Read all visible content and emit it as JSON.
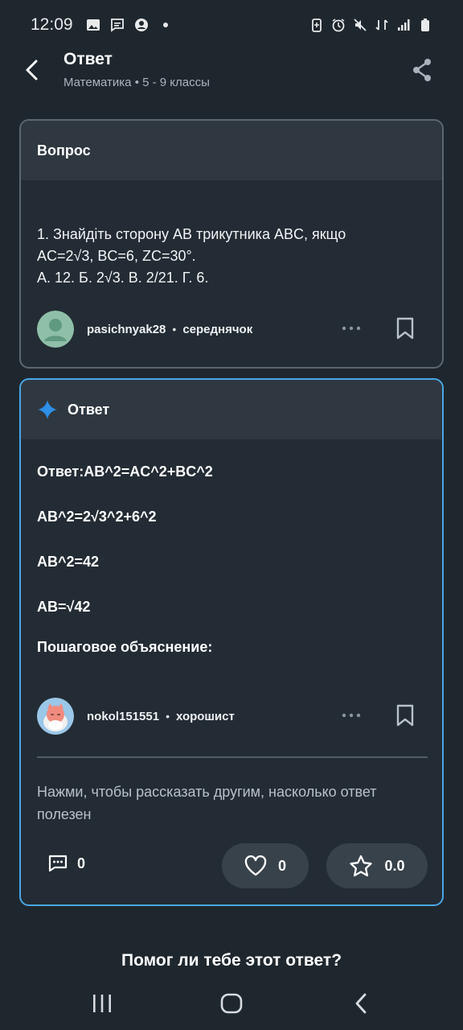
{
  "status_bar": {
    "time": "12:09"
  },
  "header": {
    "title": "Ответ",
    "subtitle": "Математика • 5 - 9 классы"
  },
  "question": {
    "header": "Вопрос",
    "lines": [
      "1. Знайдіть сторону AB трикутника ABC, якщо",
      "AC=2√3, BC=6, ZC=30°.",
      "А. 12. Б. 2√3. В. 2/21. Г. 6."
    ],
    "author": {
      "name": "pasichnyak28",
      "separator": "•",
      "rank": "середнячок"
    }
  },
  "answer": {
    "header": "Ответ",
    "lines": [
      "Ответ:AB^2=AC^2+BC^2",
      "AB^2=2√3^2+6^2",
      "AB^2=42",
      "AB=√42"
    ],
    "explanation_title": "Пошаговое объяснение:",
    "author": {
      "name": "nokol151551",
      "separator": "•",
      "rank": "хорошист"
    },
    "rate_prompt": "Нажми, чтобы рассказать другим, насколько ответ полезен",
    "comments_count": "0",
    "likes_count": "0",
    "rating": "0.0"
  },
  "footer": {
    "help_question": "Помог ли тебе этот ответ?"
  },
  "colors": {
    "background": "#1f272e",
    "card_border": "#5d6770",
    "answer_border": "#4aa7e8",
    "sparkle": "#2d8fe6"
  }
}
